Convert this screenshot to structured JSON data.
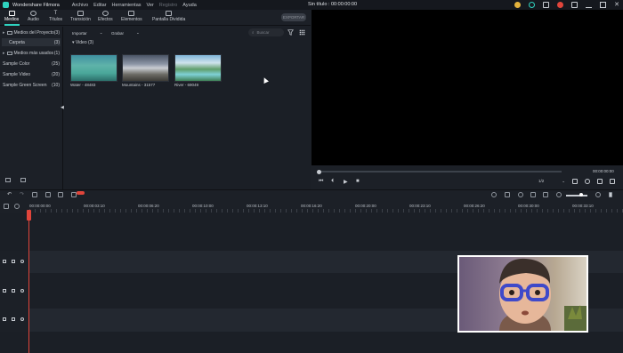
{
  "app": {
    "name": "Wondershare Filmora",
    "document_title": "Sin título : 00:00:00:00",
    "menu": [
      "Archivo",
      "Editar",
      "Herramientas",
      "Ver",
      "Registro",
      "Ayuda"
    ]
  },
  "tabs": [
    {
      "label": "Medios",
      "active": true
    },
    {
      "label": "Audio"
    },
    {
      "label": "Títulos"
    },
    {
      "label": "Transición"
    },
    {
      "label": "Efectos"
    },
    {
      "label": "Elementos"
    },
    {
      "label": "Pantalla Dividida"
    }
  ],
  "export_label": "EXPORTAR",
  "library": {
    "items": [
      {
        "label": "Medios del Proyecto",
        "count": "(3)",
        "caret": "▸",
        "folder": true
      },
      {
        "label": "Carpeta",
        "count": "(3)",
        "selected": true
      },
      {
        "label": "Medios más usados",
        "count": "(1)",
        "caret": "▸",
        "folder": true
      },
      {
        "label": "Sample Color",
        "count": "(25)"
      },
      {
        "label": "Sample Video",
        "count": "(20)"
      },
      {
        "label": "Sample Green Screen",
        "count": "(10)"
      }
    ]
  },
  "media": {
    "import_label": "Importar",
    "record_label": "Grabar",
    "search_placeholder": "Buscar",
    "section_label": "Video (3)",
    "clips": [
      {
        "name": "Water - 48483"
      },
      {
        "name": "Mountains - 31577"
      },
      {
        "name": "River - 69049"
      }
    ]
  },
  "preview": {
    "timecode": "00:00:00:00",
    "ratio": "1/2"
  },
  "ruler": {
    "labels": [
      "00:00:00:00",
      "00:00:03:10",
      "00:00:06:20",
      "00:00:10:00",
      "00:00:13:10",
      "00:00:16:20",
      "00:00:20:00",
      "00:00:23:10",
      "00:00:26:20",
      "00:00:30:00",
      "00:00:33:10"
    ]
  },
  "colors": {
    "accent": "#2fd3c0",
    "playhead": "#e0453b"
  }
}
